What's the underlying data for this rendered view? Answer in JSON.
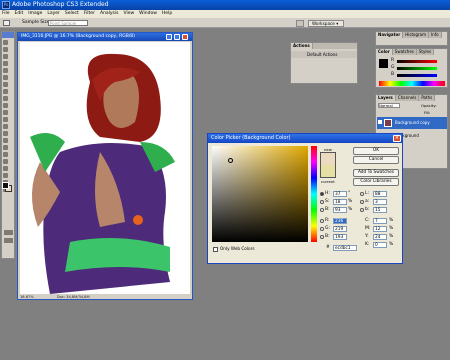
{
  "app": {
    "title": "Adobe Photoshop CS3 Extended",
    "icon_label": "Ps"
  },
  "menu": [
    "File",
    "Edit",
    "Image",
    "Layer",
    "Select",
    "Filter",
    "Analysis",
    "View",
    "Window",
    "Help"
  ],
  "options_bar": {
    "sample_size_label": "Sample Size:",
    "sample_size_value": "Point Sample",
    "workspace_label": "Workspace ▾"
  },
  "document": {
    "title": "IMG_3116.JPG @ 16.7% (Background copy, RGB/8)",
    "zoom": "16.67%",
    "doc_info": "Doc: 34,8M/34,8M"
  },
  "actions_panel": {
    "tab": "Actions",
    "item": "Default Actions"
  },
  "navigator_panel": {
    "tabs": [
      "Navigator",
      "Histogram",
      "Info"
    ]
  },
  "color_panel": {
    "tabs": [
      "Color",
      "Swatches",
      "Styles"
    ],
    "channels": [
      "R",
      "G",
      "B"
    ]
  },
  "layers_panel": {
    "tabs": [
      "Layers",
      "Channels",
      "Paths"
    ],
    "blend_mode": "Normal",
    "opacity_label": "Opacity:",
    "fill_label": "Fill:",
    "layer_name": "Background copy",
    "background_label": "Background"
  },
  "color_picker": {
    "title": "Color Picker (Background Color)",
    "new_label": "new",
    "current_label": "current",
    "buttons": {
      "ok": "OK",
      "cancel": "Cancel",
      "add_swatches": "Add To Swatches",
      "libraries": "Color Libraries"
    },
    "only_web_colors": "Only Web Colors",
    "hsb": [
      {
        "label": "H:",
        "value": "37",
        "unit": "°"
      },
      {
        "label": "S:",
        "value": "18",
        "unit": "%"
      },
      {
        "label": "B:",
        "value": "93",
        "unit": "%"
      }
    ],
    "rgb": [
      {
        "label": "R:",
        "value": "236",
        "unit": ""
      },
      {
        "label": "G:",
        "value": "219",
        "unit": ""
      },
      {
        "label": "B:",
        "value": "193",
        "unit": ""
      }
    ],
    "lab": [
      {
        "label": "L:",
        "value": "88",
        "unit": ""
      },
      {
        "label": "a:",
        "value": "3",
        "unit": ""
      },
      {
        "label": "b:",
        "value": "15",
        "unit": ""
      }
    ],
    "cmyk": [
      {
        "label": "C:",
        "value": "7",
        "unit": "%"
      },
      {
        "label": "M:",
        "value": "12",
        "unit": "%"
      },
      {
        "label": "Y:",
        "value": "24",
        "unit": "%"
      },
      {
        "label": "K:",
        "value": "0",
        "unit": "%"
      }
    ],
    "hex_label": "#",
    "hex_value": "ecdbc1",
    "new_color": "#ecdbc1",
    "current_color": "#e6e0a4"
  },
  "colors": {
    "accent": "#0a5fd8",
    "background_swatch": "#ecdbc1"
  }
}
